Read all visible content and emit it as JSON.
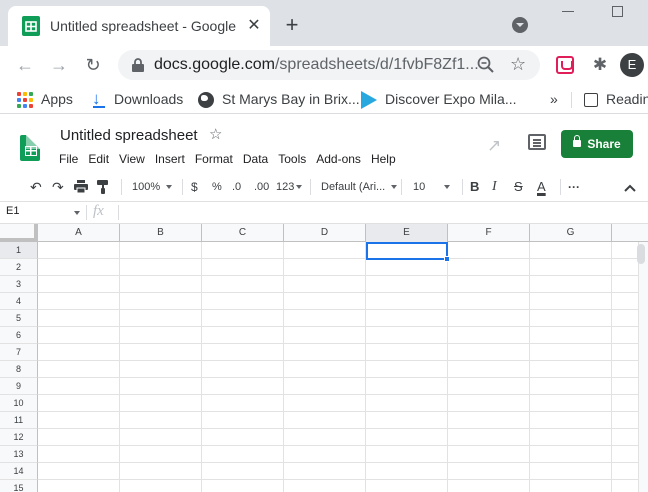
{
  "browser": {
    "tab_title": "Untitled spreadsheet - Google Sheets",
    "close_glyph": "✕",
    "new_tab_glyph": "+",
    "url_host": "docs.google.com",
    "url_path": "/spreadsheets/d/1fvbF8Zf1...",
    "avatar_letter": "E"
  },
  "bookmarks": {
    "items": [
      {
        "label": "Apps",
        "icon": "apps-grid-icon"
      },
      {
        "label": "Downloads",
        "icon": "download-icon"
      },
      {
        "label": "St Marys Bay in Brix...",
        "icon": "globe-icon"
      },
      {
        "label": "Discover Expo Mila...",
        "icon": "expo-icon"
      }
    ],
    "more": "»",
    "reading_list": "Reading list"
  },
  "doc": {
    "title": "Untitled spreadsheet",
    "menus": [
      "File",
      "Edit",
      "View",
      "Insert",
      "Format",
      "Data",
      "Tools",
      "Add-ons",
      "Help"
    ],
    "share_label": "Share"
  },
  "format_toolbar": {
    "zoom": "100%",
    "currency": "$",
    "percent": "%",
    "decrease_decimal": ".0",
    "increase_decimal": ".00",
    "more_formats": "123",
    "font": "Default (Ari...",
    "font_size": "10",
    "bold": "B",
    "italic": "I",
    "strikethrough": "S",
    "text_color": "A",
    "more": "···"
  },
  "formula_bar": {
    "cell_ref": "E1",
    "fx": "fx"
  },
  "grid": {
    "columns": [
      "A",
      "B",
      "C",
      "D",
      "E",
      "F",
      "G"
    ],
    "rows": [
      "1",
      "2",
      "3",
      "4",
      "5",
      "6",
      "7",
      "8",
      "9",
      "10",
      "11",
      "12",
      "13",
      "14",
      "15"
    ],
    "selected_column": "E",
    "selected_row": "1"
  },
  "colors": {
    "selection": "#1a73e8",
    "share_button": "#188038",
    "sheets_green": "#0f9d58"
  }
}
